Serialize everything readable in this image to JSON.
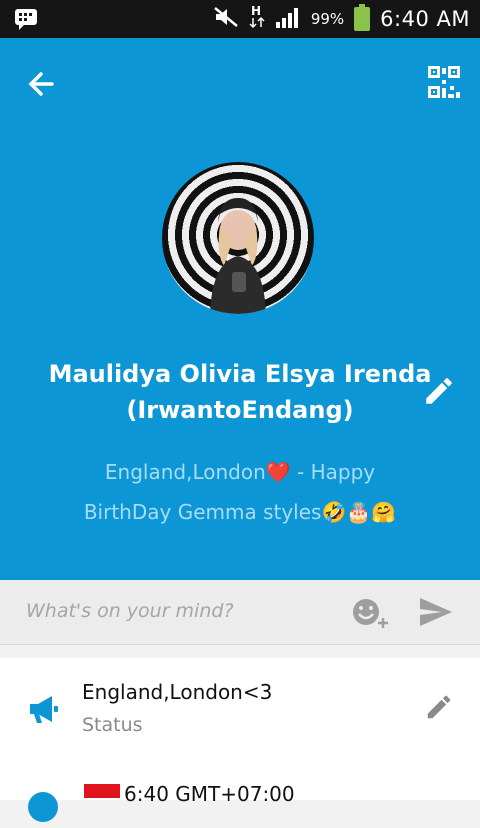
{
  "status_bar": {
    "battery_percent": "99%",
    "battery_level": 0.99,
    "time": "6:40 AM",
    "icons": [
      "bbm-notification-icon",
      "mute-icon",
      "hsdpa-icon",
      "signal-icon",
      "battery-icon"
    ]
  },
  "header": {
    "background": "#0d96d6",
    "name_line1": "Maulidya Olivia Elsya Irenda",
    "name_line2": "(IrwantoEndang)",
    "tagline_line1": "England,London❤️ - Happy",
    "tagline_line2": "BirthDay Gemma styles🤣🎂🤗"
  },
  "composer": {
    "placeholder": "What's on your mind?"
  },
  "status_row": {
    "title": "England,London<3",
    "subtitle": "Status"
  },
  "timezone_row": {
    "text": "6:40 GMT+07:00"
  }
}
